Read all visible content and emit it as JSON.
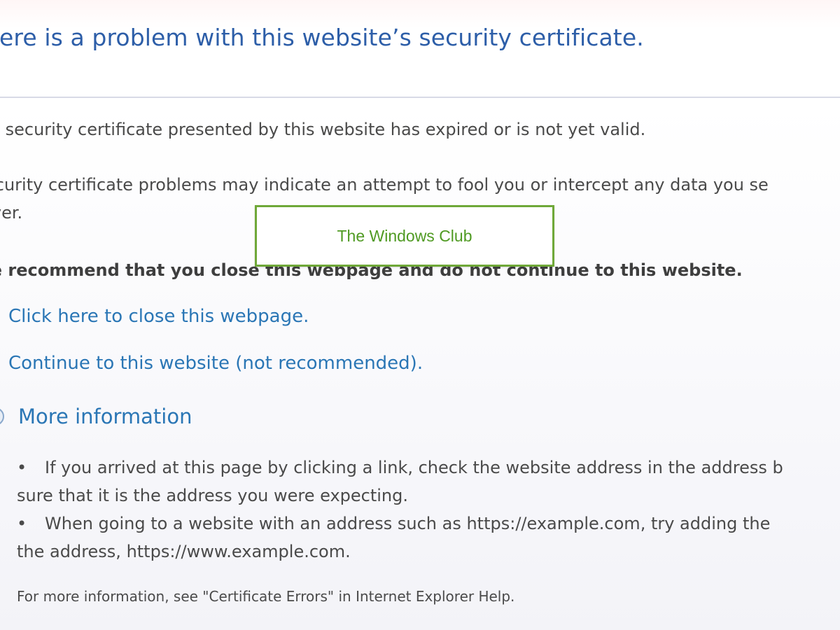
{
  "heading": "here is a problem with this website’s security certificate.",
  "body": {
    "line1": "he security certificate presented by this website has expired or is not yet valid.",
    "line2a": "ecurity certificate problems may indicate an attempt to fool you or intercept any data you se",
    "line2b": "rver.",
    "recommendation": "/e recommend that you close this webpage and do not continue to this website."
  },
  "links": {
    "close": "Click here to close this webpage.",
    "continue": "Continue to this website (not recommended)."
  },
  "more_info": {
    "label": "More information",
    "bullet_char": "•",
    "bullet1a": "If you arrived at this page by clicking a link, check the website address in the address b",
    "bullet1b": "sure that it is the address you were expecting.",
    "bullet2a": "When going to a website with an address such as https://example.com, try adding the",
    "bullet2b": "the address, https://www.example.com.",
    "footnote": "For more information, see \"Certificate Errors\" in Internet Explorer Help."
  },
  "watermark": {
    "text": "The Windows Club",
    "color": "#4f9a22",
    "border_color": "#6fa838"
  },
  "colors": {
    "heading": "#2d5ea8",
    "link": "#2a76b5",
    "text": "#4a4a4a"
  },
  "icons": {
    "close_link": "green-shield-icon",
    "continue_link": "red-shield-icon",
    "more_info": "expand-circle-icon"
  }
}
